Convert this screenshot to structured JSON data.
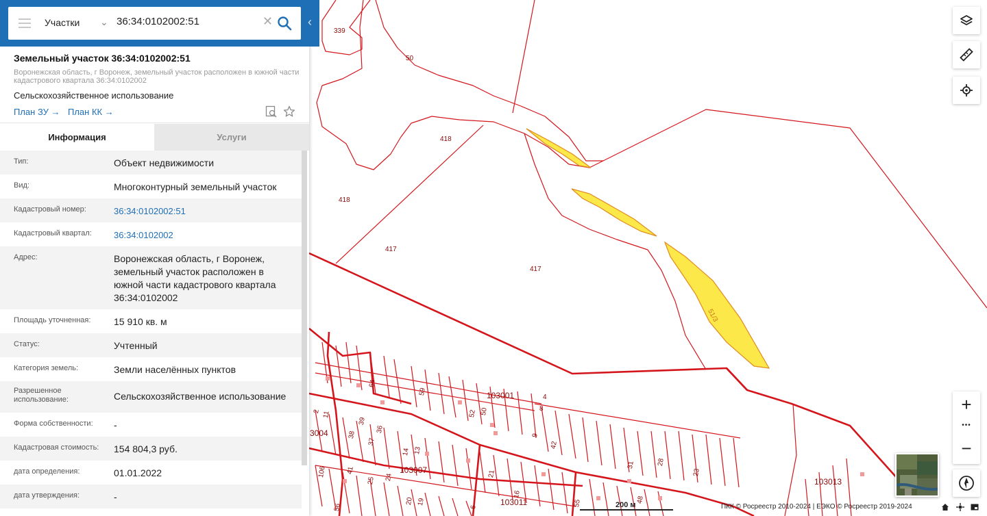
{
  "search": {
    "type_label": "Участки",
    "query": "36:34:0102002:51"
  },
  "object": {
    "title": "Земельный участок 36:34:0102002:51",
    "address_short": "Воронежская область, г Воронеж, земельный участок расположен в южной части кадастрового квартала 36:34:0102002",
    "use": "Сельскохозяйственное использование",
    "plan_zu": "План ЗУ",
    "plan_kk": "План КК",
    "arrow": "→"
  },
  "tabs": {
    "info": "Информация",
    "services": "Услуги"
  },
  "info_rows": [
    {
      "label": "Тип:",
      "value": "Объект недвижимости"
    },
    {
      "label": "Вид:",
      "value": "Многоконтурный земельный участок"
    },
    {
      "label": "Кадастровый номер:",
      "value": "36:34:0102002:51"
    },
    {
      "label": "Кадастровый квартал:",
      "value": "36:34:0102002"
    },
    {
      "label": "Адрес:",
      "value": "Воронежская область, г Воронеж, земельный участок расположен в южной части кадастрового квартала 36:34:0102002"
    },
    {
      "label": "Площадь уточненная:",
      "value": "15 910 кв. м"
    },
    {
      "label": "Статус:",
      "value": "Учтенный"
    },
    {
      "label": "Категория земель:",
      "value": "Земли населённых пунктов"
    },
    {
      "label": "Разрешенное использование:",
      "value": "Сельскохозяйственное использование"
    },
    {
      "label": "Форма собственности:",
      "value": "-"
    },
    {
      "label": "Кадастровая стоимость:",
      "value": "154 804,3 руб."
    },
    {
      "label": "дата определения:",
      "value": "01.01.2022"
    },
    {
      "label": "дата утверждения:",
      "value": "-"
    }
  ],
  "map": {
    "parcel_labels": [
      "339",
      "50",
      "418",
      "418",
      "417",
      "417",
      "51/3"
    ],
    "quarter_labels": [
      "103001",
      "103007",
      "103011",
      "103013",
      "3004"
    ],
    "house_numbers": [
      "64",
      "59",
      "4",
      "8",
      "52",
      "50",
      "9",
      "42",
      "2",
      "11",
      "38",
      "39",
      "36",
      "37",
      "14",
      "13",
      "106",
      "41",
      "25",
      "24",
      "20",
      "19",
      "21",
      "16",
      "23",
      "28",
      "31",
      "48",
      "55",
      "56",
      "6"
    ],
    "colors": {
      "boundary": "#d4161c",
      "selected_fill": "#fde84a",
      "selected_stroke": "#e08b1f"
    }
  },
  "controls": {
    "zoom_in": "+",
    "more": "•••",
    "zoom_out": "−",
    "icons": [
      "layers-icon",
      "ruler-icon",
      "locate-icon",
      "compass-icon"
    ]
  },
  "footer": {
    "scale": "200 м",
    "attribution": "ПКК © Росреестр 2010-2024 | ЕЭКО © Росреестр 2019-2024"
  },
  "accent": "#1f6fb6"
}
